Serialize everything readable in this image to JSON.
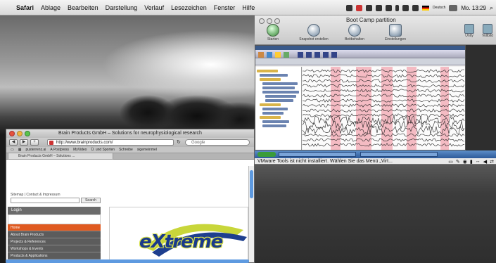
{
  "menubar": {
    "apple": "",
    "items": [
      "Safari",
      "Ablage",
      "Bearbeiten",
      "Darstellung",
      "Verlauf",
      "Lesezeichen",
      "Fenster",
      "Hilfe"
    ],
    "input_source": "Deutsch",
    "clock": "Mo. 13:29"
  },
  "vm_window": {
    "title": "Boot Camp partition",
    "tools": [
      "Starten",
      "Snapshot erstellen",
      "Beitbehalten",
      "Einstellungen"
    ],
    "right_tools": [
      "Unity",
      "Vollbild"
    ]
  },
  "eeg_window": {
    "highlight_color": "#f2a6b0"
  },
  "vmware_message": {
    "text": "VMware Tools ist nicht installiert. Wählen Sie das Menü „Virt..."
  },
  "safari": {
    "title": "Brain Products GmbH – Solutions for neurophysiological research",
    "url": "http://www.brainproducts.com/",
    "search_placeholder": "Google",
    "bookmarks": [
      "pusterrenz.ai",
      "A Postpress",
      "MyVideo",
      "Ü. und Sporten",
      "Schreibe",
      "sigemeinmel"
    ],
    "tab": "Brain Products GmbH – Solutions ...",
    "site": {
      "links": "Sitemap | Contact & Impressum",
      "search_button": "Search",
      "login_title": "Login",
      "nav": [
        "Home",
        "About Brain Products",
        "Projects & References",
        "Workshops & Events",
        "Products & Applications"
      ],
      "logo": "eXtreme"
    }
  }
}
